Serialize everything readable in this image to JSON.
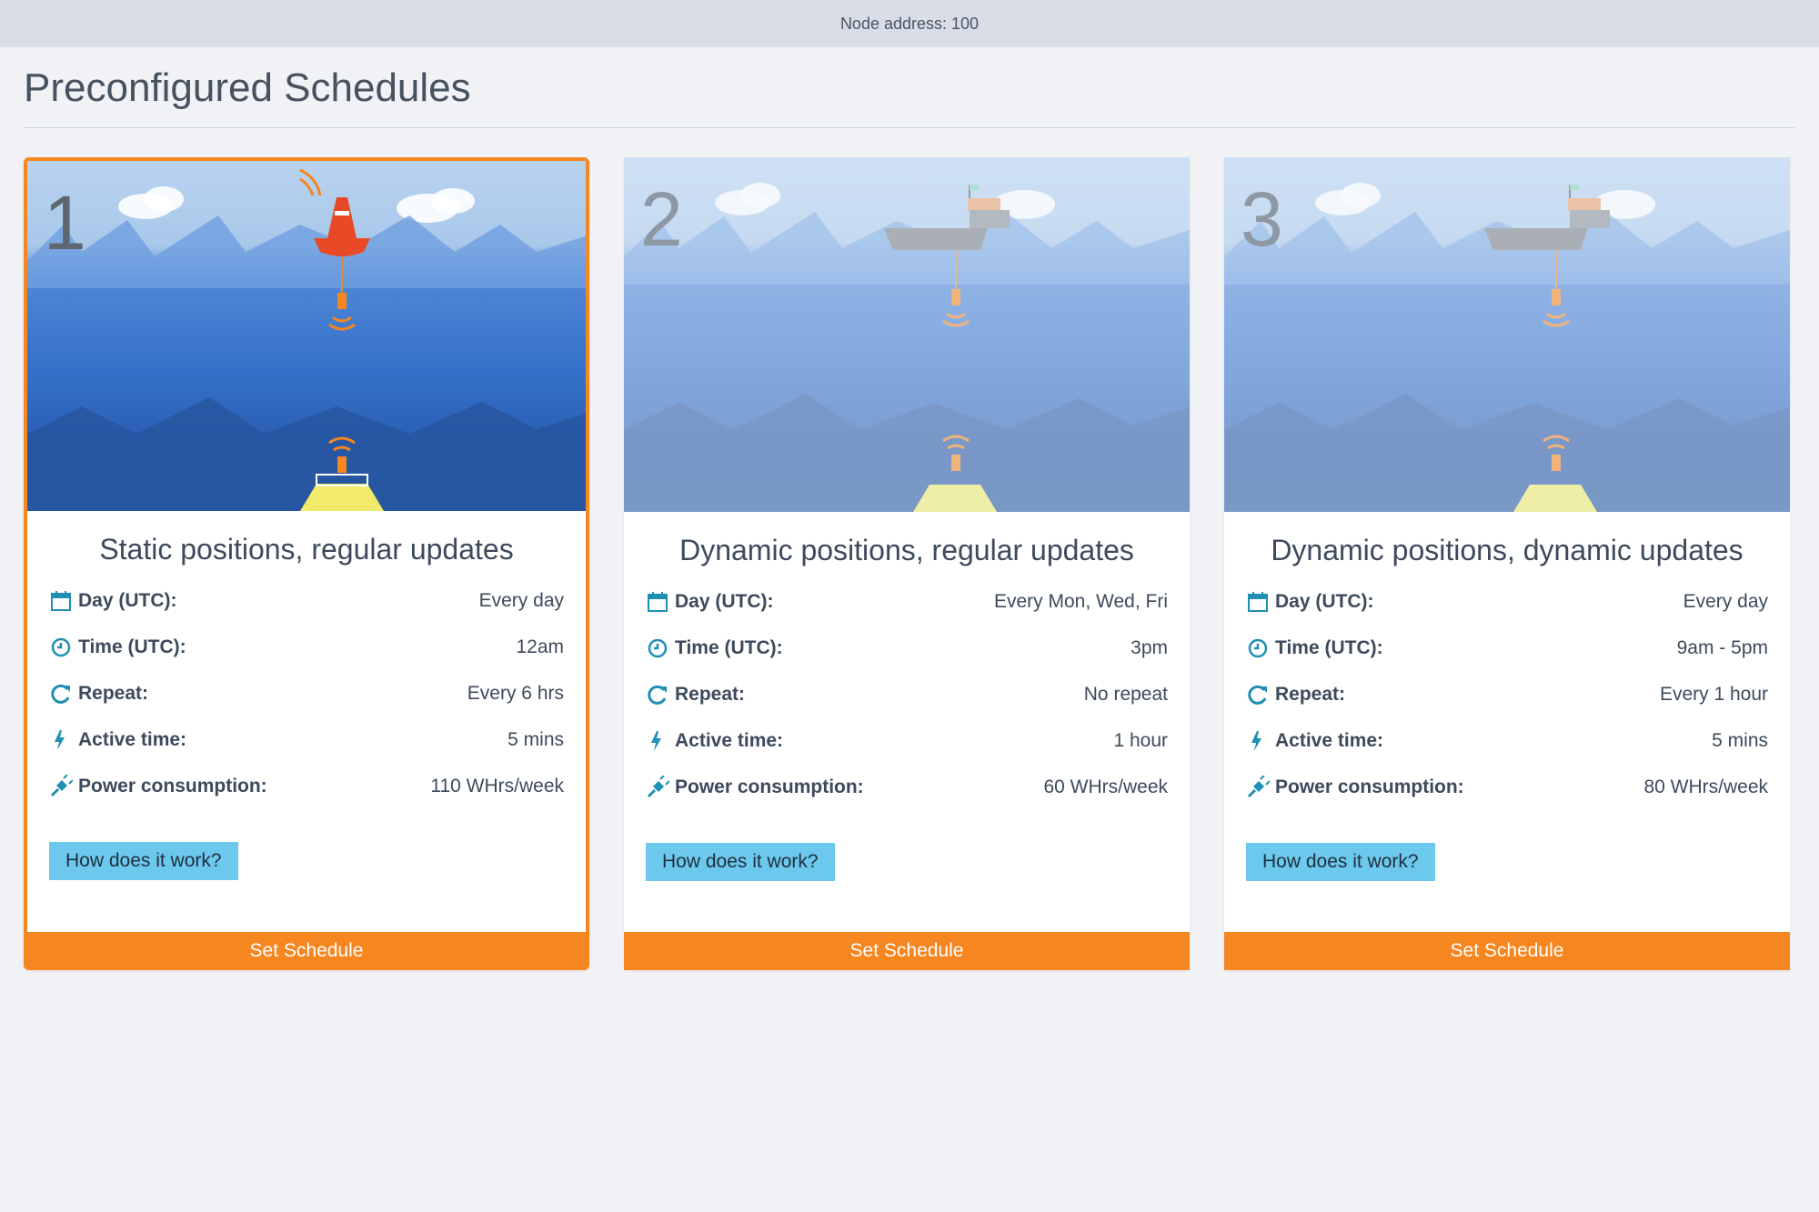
{
  "topbar": {
    "node_address": "Node address: 100"
  },
  "page": {
    "title": "Preconfigured Schedules"
  },
  "labels": {
    "day": "Day (UTC):",
    "time": "Time (UTC):",
    "repeat": "Repeat:",
    "active": "Active time:",
    "power": "Power consumption:",
    "how": "How does it work?",
    "set": "Set Schedule"
  },
  "cards": [
    {
      "number": "1",
      "title": "Static positions, regular updates",
      "day": "Every day",
      "time": "12am",
      "repeat": "Every 6 hrs",
      "active": "5 mins",
      "power": "110 WHrs/week",
      "selected": true
    },
    {
      "number": "2",
      "title": "Dynamic positions, regular updates",
      "day": "Every Mon, Wed, Fri",
      "time": "3pm",
      "repeat": "No repeat",
      "active": "1 hour",
      "power": "60 WHrs/week",
      "selected": false
    },
    {
      "number": "3",
      "title": "Dynamic positions, dynamic updates",
      "day": "Every day",
      "time": "9am - 5pm",
      "repeat": "Every 1 hour",
      "active": "5 mins",
      "power": "80 WHrs/week",
      "selected": false
    }
  ],
  "colors": {
    "accent": "#f68620",
    "button": "#6cc8ec",
    "icon": "#1f8fb3"
  },
  "icons": [
    "calendar-icon",
    "clock-icon",
    "refresh-icon",
    "bolt-icon",
    "plug-icon"
  ]
}
